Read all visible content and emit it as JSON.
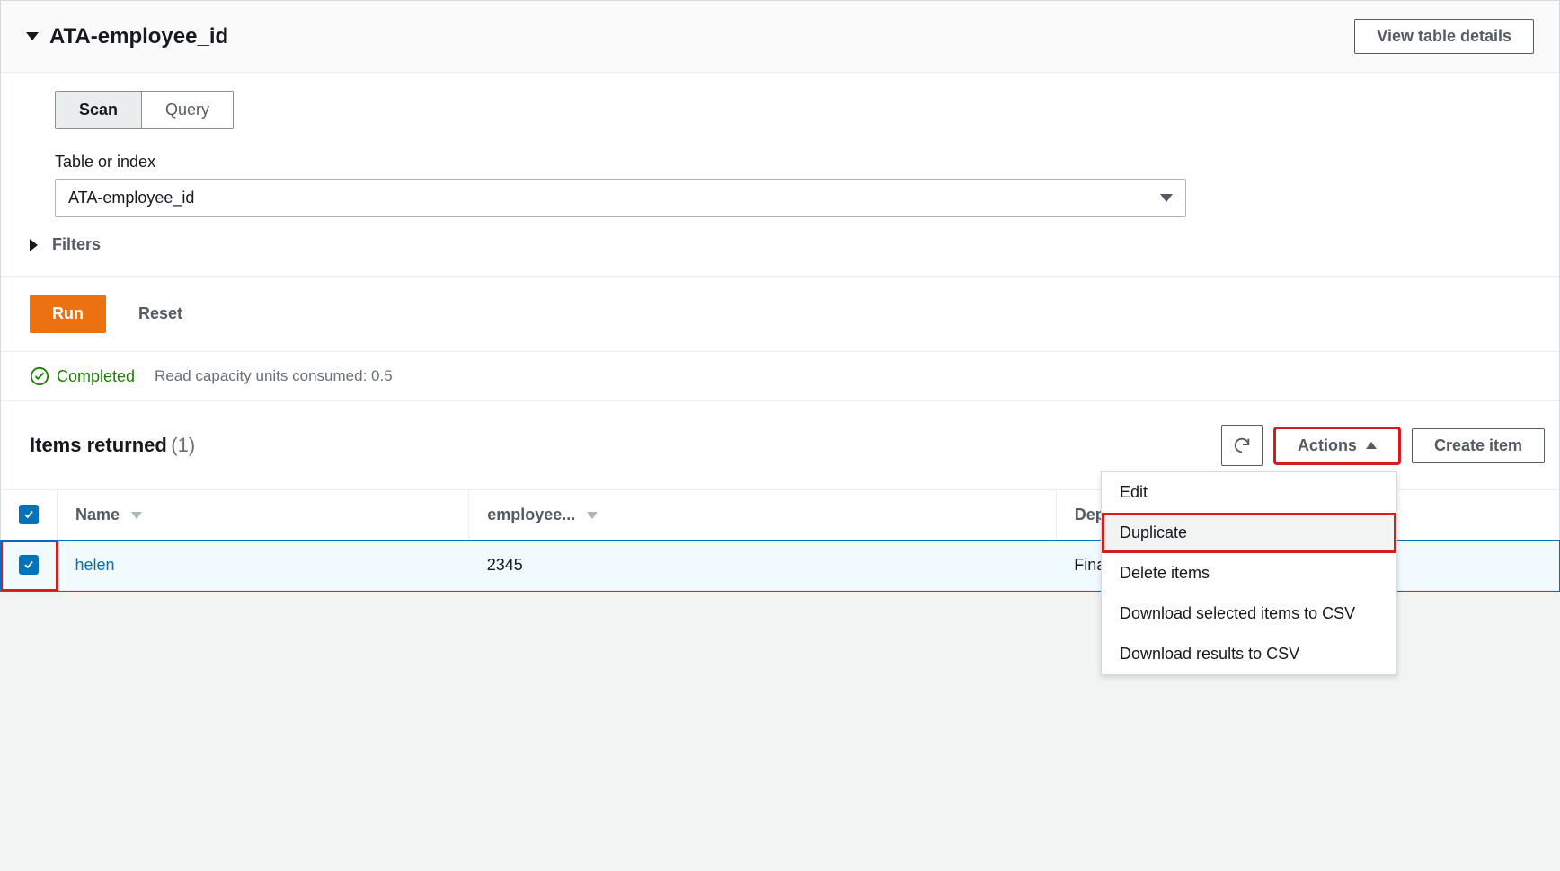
{
  "header": {
    "title": "ATA-employee_id",
    "view_details_label": "View table details"
  },
  "tabs": {
    "scan": "Scan",
    "query": "Query"
  },
  "table_select": {
    "label": "Table or index",
    "value": "ATA-employee_id"
  },
  "filters_label": "Filters",
  "run_label": "Run",
  "reset_label": "Reset",
  "status": {
    "text": "Completed",
    "meta": "Read capacity units consumed: 0.5"
  },
  "items": {
    "title": "Items returned",
    "count": "(1)",
    "actions_label": "Actions",
    "create_label": "Create item"
  },
  "dropdown": {
    "edit": "Edit",
    "duplicate": "Duplicate",
    "delete": "Delete items",
    "dl_selected": "Download selected items to CSV",
    "dl_results": "Download results to CSV"
  },
  "columns": {
    "name": "Name",
    "employee": "employee...",
    "department": "Department"
  },
  "rows": [
    {
      "name": "helen",
      "employee": "2345",
      "department": "Finance"
    }
  ]
}
